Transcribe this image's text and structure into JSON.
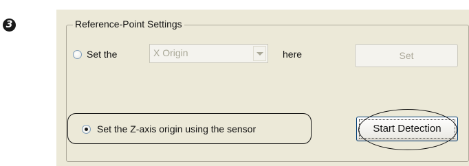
{
  "step_number": "3",
  "group": {
    "title": "Reference-Point Settings"
  },
  "option_origin": {
    "prefix": "Set the",
    "dropdown_value": "X Origin",
    "suffix": "here",
    "selected": false
  },
  "set_button": {
    "label": "Set",
    "enabled": false
  },
  "option_sensor": {
    "label": "Set the Z-axis origin using the sensor",
    "selected": true
  },
  "start_detection_button": {
    "label": "Start Detection",
    "enabled": true
  },
  "colors": {
    "dialog_bg": "#ece9d8",
    "disabled_text": "#aca899",
    "button_border": "#003c74"
  }
}
